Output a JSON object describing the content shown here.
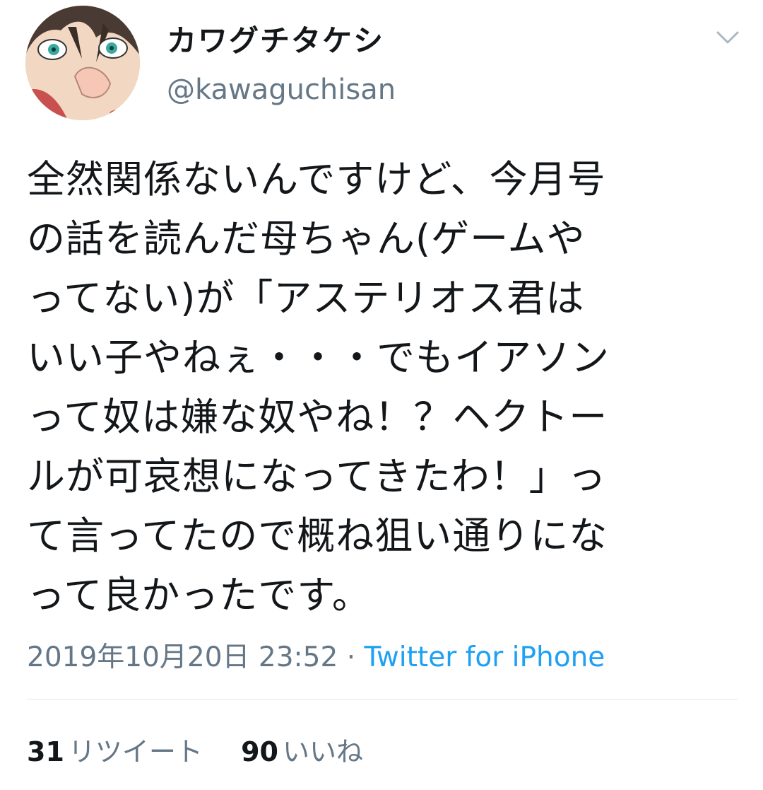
{
  "tweet": {
    "display_name": "カワグチタケシ",
    "handle": "@kawaguchisan",
    "text": "全然関係ないんですけど、今月号\nの話を読んだ母ちゃん(ゲームや\nってない)が「アステリオス君は\nいい子やねぇ・・・でもイアソン\nって奴は嫌な奴やね！？ヘクトー\nルが可哀想になってきたわ！」っ\nて言ってたので概ね狙い通りにな\nって良かったです。",
    "timestamp": "2019年10月20日 23:52",
    "separator": "·",
    "source": "Twitter for iPhone"
  },
  "stats": {
    "retweets_count": "31",
    "retweets_label": "リツイート",
    "likes_count": "90",
    "likes_label": "いいね"
  },
  "icons": {
    "menu": "chevron-down-icon",
    "avatar": "avatar-image"
  },
  "colors": {
    "text": "#14171a",
    "secondary": "#657786",
    "link": "#1da1f2",
    "divider": "#e1e8ed"
  }
}
